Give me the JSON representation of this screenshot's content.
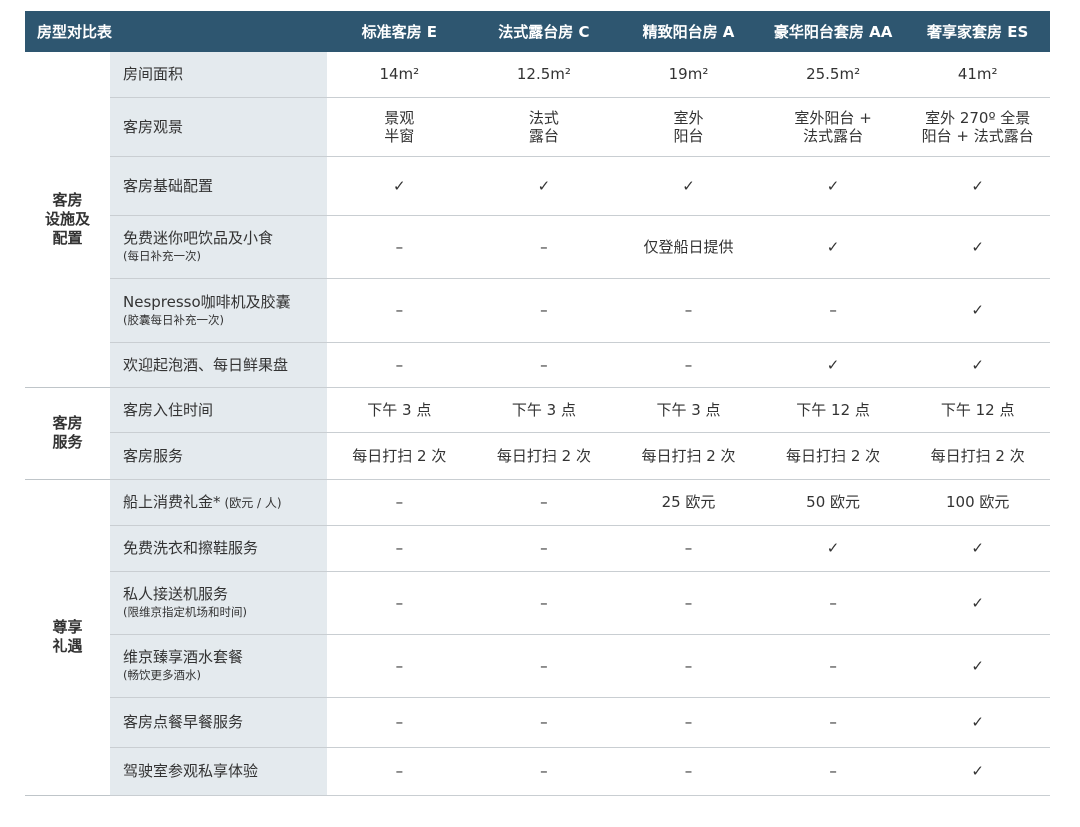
{
  "table": {
    "corner_label": "房型对比表",
    "room_types": [
      "标准客房 E",
      "法式露台房 C",
      "精致阳台房 A",
      "豪华阳台套房 AA",
      "奢享家套房 ES"
    ],
    "groups": [
      {
        "label": "客房\n设施及\n配置",
        "rows": [
          {
            "feature": "房间面积",
            "note": "",
            "values": [
              "14m²",
              "12.5m²",
              "19m²",
              "25.5m²",
              "41m²"
            ],
            "height": 45
          },
          {
            "feature": "客房观景",
            "note": "",
            "values": [
              "景观\n半窗",
              "法式\n露台",
              "室外\n阳台",
              "室外阳台 +\n法式露台",
              "室外 270º 全景\n阳台 + 法式露台"
            ],
            "height": 59
          },
          {
            "feature": "客房基础配置",
            "note": "",
            "values": [
              "✓",
              "✓",
              "✓",
              "✓",
              "✓"
            ],
            "height": 59
          },
          {
            "feature": "免费迷你吧饮品及小食",
            "note": "(每日补充一次)",
            "values": [
              "–",
              "–",
              "仅登船日提供",
              "✓",
              "✓"
            ],
            "height": 63
          },
          {
            "feature": "Nespresso咖啡机及胶囊",
            "note": "(胶囊每日补充一次)",
            "values": [
              "–",
              "–",
              "–",
              "–",
              "✓"
            ],
            "height": 64
          },
          {
            "feature": "欢迎起泡酒、每日鲜果盘",
            "note": "",
            "values": [
              "–",
              "–",
              "–",
              "✓",
              "✓"
            ],
            "height": 45
          }
        ]
      },
      {
        "label": "客房\n服务",
        "rows": [
          {
            "feature": "客房入住时间",
            "note": "",
            "values": [
              "下午 3 点",
              "下午 3 点",
              "下午 3 点",
              "下午 12 点",
              "下午 12 点"
            ],
            "height": 45
          },
          {
            "feature": "客房服务",
            "note": "",
            "values": [
              "每日打扫 2 次",
              "每日打扫 2 次",
              "每日打扫 2 次",
              "每日打扫 2 次",
              "每日打扫 2 次"
            ],
            "height": 47
          }
        ]
      },
      {
        "label": "尊享\n礼遇",
        "rows": [
          {
            "feature": "船上消费礼金*",
            "note_inline": "(欧元 / 人)",
            "note": "",
            "values": [
              "–",
              "–",
              "25 欧元",
              "50 欧元",
              "100 欧元"
            ],
            "height": 46
          },
          {
            "feature": "免费洗衣和擦鞋服务",
            "note": "",
            "values": [
              "–",
              "–",
              "–",
              "✓",
              "✓"
            ],
            "height": 46
          },
          {
            "feature": "私人接送机服务",
            "note": "(限维京指定机场和时间)",
            "values": [
              "–",
              "–",
              "–",
              "–",
              "✓"
            ],
            "height": 63
          },
          {
            "feature": "维京臻享酒水套餐",
            "note": "(畅饮更多酒水)",
            "values": [
              "–",
              "–",
              "–",
              "–",
              "✓"
            ],
            "height": 63
          },
          {
            "feature": "客房点餐早餐服务",
            "note": "",
            "values": [
              "–",
              "–",
              "–",
              "–",
              "✓"
            ],
            "height": 50
          },
          {
            "feature": "驾驶室参观私享体验",
            "note": "",
            "values": [
              "–",
              "–",
              "–",
              "–",
              "✓"
            ],
            "height": 48
          }
        ]
      }
    ]
  }
}
